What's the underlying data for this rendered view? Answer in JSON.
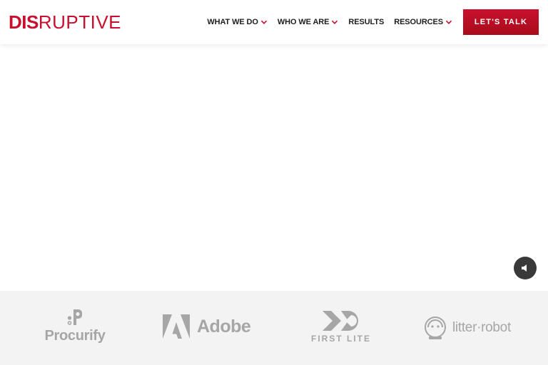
{
  "brand": {
    "logo_bold": "DIS",
    "logo_rest": "RUPTIVE",
    "accent_color": "#c8102e"
  },
  "nav": {
    "items": [
      {
        "label": "WHAT WE DO",
        "has_dropdown": true
      },
      {
        "label": "WHO WE ARE",
        "has_dropdown": true
      },
      {
        "label": "RESULTS",
        "has_dropdown": false
      },
      {
        "label": "RESOURCES",
        "has_dropdown": true
      }
    ],
    "cta_label": "LET'S TALK"
  },
  "hero": {
    "mute_icon": "speaker-muted-icon"
  },
  "clients": [
    {
      "name": "Procurify",
      "icon": "procurify-logo-icon"
    },
    {
      "name": "Adobe",
      "icon": "adobe-logo-icon"
    },
    {
      "name": "FIRST LITE",
      "icon": "first-lite-logo-icon"
    },
    {
      "name": "litter·robot",
      "icon": "litter-robot-logo-icon"
    }
  ]
}
